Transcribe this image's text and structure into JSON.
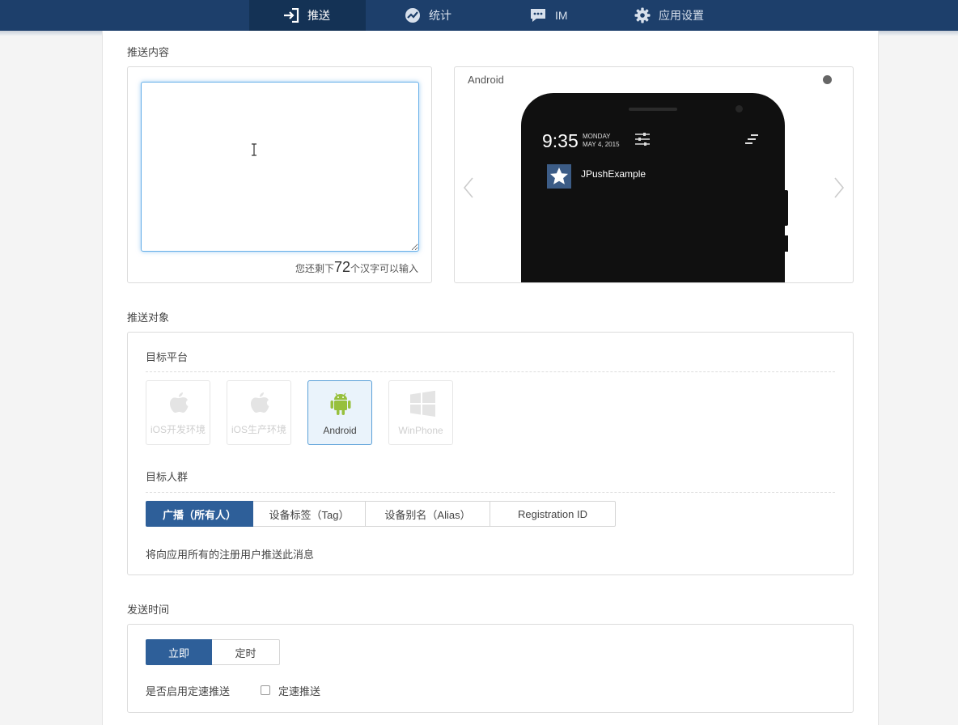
{
  "nav": {
    "items": [
      {
        "label": "推送",
        "icon": "sign-in-icon"
      },
      {
        "label": "统计",
        "icon": "chart-icon"
      },
      {
        "label": "IM",
        "icon": "chat-icon"
      },
      {
        "label": "应用设置",
        "icon": "gear-icon"
      }
    ]
  },
  "content": {
    "title": "推送内容",
    "textarea_value": "",
    "remain_prefix": "您还剩下",
    "remain_count": "72",
    "remain_suffix": "个汉字可以输入"
  },
  "preview": {
    "platform_label": "Android",
    "time": "9:35",
    "day": "MONDAY",
    "date": "MAY 4, 2015",
    "notification_title": "JPushExample"
  },
  "target": {
    "title": "推送对象",
    "platform_title": "目标平台",
    "platforms": [
      {
        "label": "iOS开发环境",
        "icon": "apple-icon",
        "selected": false
      },
      {
        "label": "iOS生产环境",
        "icon": "apple-icon",
        "selected": false
      },
      {
        "label": "Android",
        "icon": "android-icon",
        "selected": true
      },
      {
        "label": "WinPhone",
        "icon": "windows-icon",
        "selected": false
      }
    ],
    "audience_title": "目标人群",
    "audience_options": [
      "广播（所有人）",
      "设备标签（Tag）",
      "设备别名（Alias）",
      "Registration ID"
    ],
    "audience_selected": 0,
    "audience_desc": "将向应用所有的注册用户推送此消息"
  },
  "send_time": {
    "title": "发送时间",
    "options": [
      "立即",
      "定时"
    ],
    "selected": 0,
    "rate_question": "是否启用定速推送",
    "rate_checkbox_label": "定速推送",
    "rate_checked": false
  },
  "colors": {
    "nav_bg": "#1d3f6b",
    "primary": "#2e5f99",
    "android_green": "#97c03d"
  }
}
